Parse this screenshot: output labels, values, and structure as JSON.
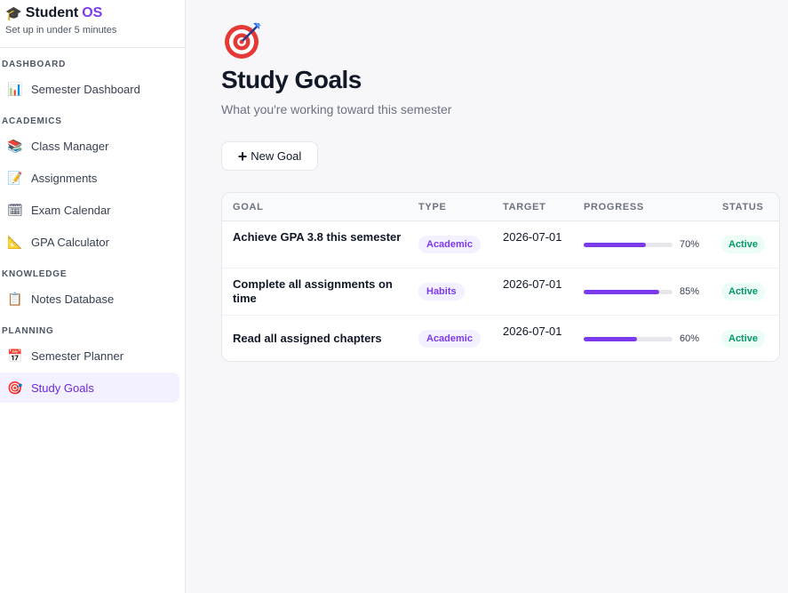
{
  "brand": {
    "name": "Student",
    "name_accent": "OS",
    "subtitle": "Set up in under 5 minutes",
    "icon": "graduation-cap-icon"
  },
  "sidebar": {
    "sections": [
      {
        "label": "DASHBOARD",
        "items": [
          {
            "label": "Semester Dashboard",
            "icon": "bar-chart-icon"
          }
        ]
      },
      {
        "label": "ACADEMICS",
        "items": [
          {
            "label": "Class Manager",
            "icon": "books-icon"
          },
          {
            "label": "Assignments",
            "icon": "memo-icon"
          },
          {
            "label": "Exam Calendar",
            "icon": "calendar-icon"
          },
          {
            "label": "GPA Calculator",
            "icon": "triangle-ruler-icon"
          }
        ]
      },
      {
        "label": "KNOWLEDGE",
        "items": [
          {
            "label": "Notes Database",
            "icon": "clipboard-icon"
          }
        ]
      },
      {
        "label": "PLANNING",
        "items": [
          {
            "label": "Semester Planner",
            "icon": "planner-icon"
          },
          {
            "label": "Study Goals",
            "icon": "target-icon",
            "active": true
          }
        ]
      }
    ]
  },
  "page": {
    "icon": "target-icon",
    "title": "Study Goals",
    "subtitle": "What you're working toward this semester",
    "new_button": "New Goal"
  },
  "table": {
    "columns": [
      "GOAL",
      "TYPE",
      "TARGET",
      "PROGRESS",
      "STATUS"
    ],
    "rows": [
      {
        "goal": "Achieve GPA 3.8 this semester",
        "type": "Academic",
        "target": "2026-07-01",
        "progress": 70,
        "progress_label": "70%",
        "status": "Active"
      },
      {
        "goal": "Complete all assignments on time",
        "type": "Habits",
        "target": "2026-07-01",
        "progress": 85,
        "progress_label": "85%",
        "status": "Active"
      },
      {
        "goal": "Read all assigned chapters",
        "type": "Academic",
        "target": "2026-07-01",
        "progress": 60,
        "progress_label": "60%",
        "status": "Active"
      }
    ]
  },
  "colors": {
    "accent": "#7c3aed",
    "status_active": "#059669",
    "active_nav_bg": "#f3f0ff"
  }
}
